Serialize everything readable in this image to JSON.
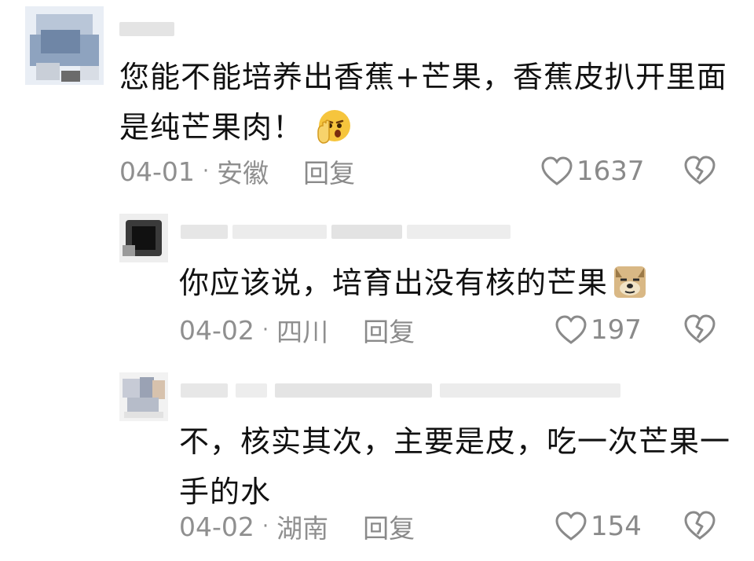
{
  "comments": [
    {
      "text_lines": [
        "您能不能培养出香蕉+芒果，香蕉皮扒开里面",
        "是纯芒果肉！"
      ],
      "emoji": "shocked-hand-emoji",
      "date": "04-01",
      "region": "安徽",
      "reply_label": "回复",
      "likes": "1637"
    },
    {
      "text_lines": [
        "你应该说，培育出没有核的芒果"
      ],
      "emoji": "doge-emoji",
      "date": "04-02",
      "region": "四川",
      "reply_label": "回复",
      "likes": "197"
    },
    {
      "text_lines": [
        "不，核实其次，主要是皮，吃一次芒果一",
        "手的水"
      ],
      "emoji": "",
      "date": "04-02",
      "region": "湖南",
      "reply_label": "回复",
      "likes": "154"
    }
  ],
  "icons": {
    "like": "heart-outline-icon",
    "dislike": "broken-heart-icon"
  },
  "colors": {
    "text": "#111111",
    "meta": "#8f8f8f",
    "icon": "#8a8a8a"
  }
}
